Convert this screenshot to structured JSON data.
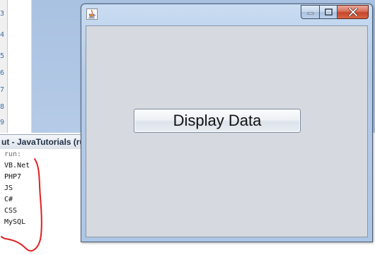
{
  "ide": {
    "gutter_digits": [
      "3",
      "4",
      "5",
      "6",
      "7",
      "8",
      "9"
    ],
    "output_tab_title": "ut - JavaTutorials (ru",
    "output_lines": [
      "run:",
      "VB.Net",
      "PHP7",
      "JS",
      "C#",
      "CSS",
      "MySQL"
    ]
  },
  "window": {
    "title": "",
    "button_label": "Display Data"
  },
  "colors": {
    "annotation_red": "#e02020",
    "client_background": "#d6d9df",
    "close_button": "#c74527"
  }
}
